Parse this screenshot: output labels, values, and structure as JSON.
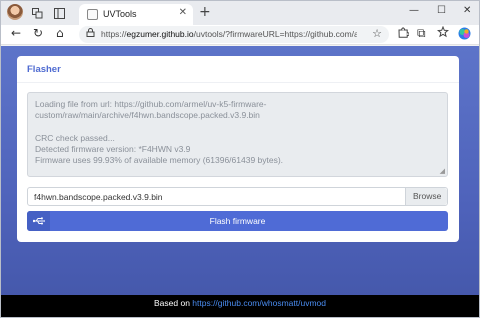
{
  "browser": {
    "tab_title": "UVTools",
    "tab_close": "✕",
    "new_tab": "+",
    "minimize": "—",
    "maximize": "☐",
    "close": "✕",
    "url_host": "egzumer.github.io",
    "url_prefix": "https://",
    "url_rest": "/uvtools/?firmwareURL=https://github.com/armel/uv..."
  },
  "icons": {
    "back": "←",
    "reload": "↻",
    "home": "⌂",
    "lock": "⓵",
    "star": "☆",
    "extensions": "◔",
    "split": "⧉",
    "favorites": "☆",
    "copilot": "◆"
  },
  "card": {
    "title": "Flasher"
  },
  "log": {
    "lines": [
      "Loading file from url: https://github.com/armel/uv-k5-firmware-",
      "custom/raw/main/archive/f4hwn.bandscope.packed.v3.9.bin",
      "",
      "CRC check passed...",
      "Detected firmware version: *F4HWN v3.9",
      "Firmware uses 99.93% of available memory (61396/61439 bytes)."
    ]
  },
  "file": {
    "name": "f4hwn.bandscope.packed.v3.9.bin",
    "browse_label": "Browse"
  },
  "flash": {
    "label": "Flash firmware"
  },
  "footer": {
    "prefix": "Based on ",
    "link": "https://github.com/whosmatt/uvmod"
  },
  "colors": {
    "accent": "#4f6bd6",
    "page_bg": "#5d74c9",
    "footer_bg": "#000000",
    "link": "#4a8cf0"
  }
}
